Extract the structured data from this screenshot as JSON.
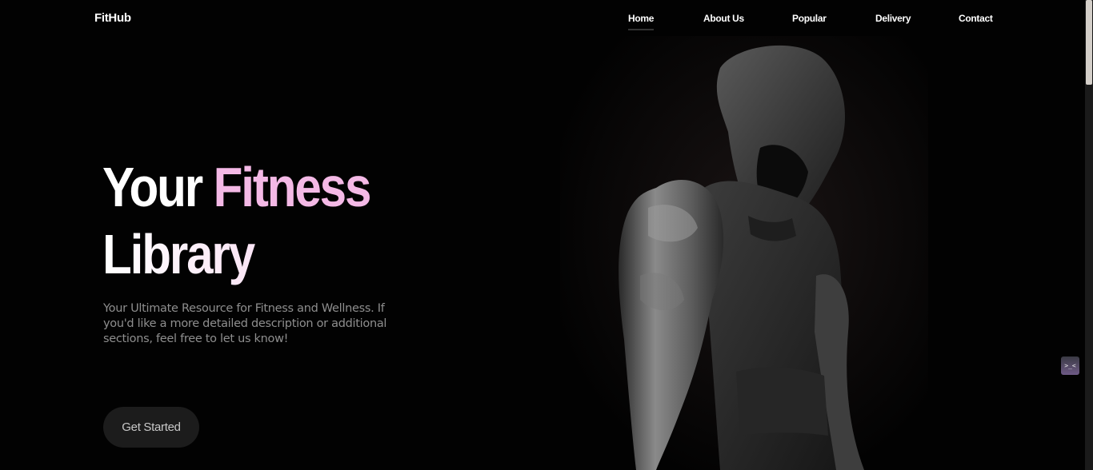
{
  "header": {
    "logo": "FitHub",
    "nav": [
      {
        "label": "Home",
        "active": true
      },
      {
        "label": "About Us",
        "active": false
      },
      {
        "label": "Popular",
        "active": false
      },
      {
        "label": "Delivery",
        "active": false
      },
      {
        "label": "Contact",
        "active": false
      }
    ]
  },
  "hero": {
    "title_part1": "Your ",
    "title_accent": "Fitness",
    "title_line2": "Library",
    "description": "Your Ultimate Resource for Fitness and Wellness. If you'd like a more detailed description or additional sections, feel free to let us know!",
    "cta_label": "Get Started",
    "image_icon": "hooded-athlete-illustration"
  },
  "widget": {
    "icon": "chat-face-icon",
    "glyph": ">_<"
  },
  "colors": {
    "background": "#020202",
    "accent_pink": "#f4b9e6",
    "button_bg": "#1c1c1c",
    "text_muted": "#8e8e8e"
  }
}
